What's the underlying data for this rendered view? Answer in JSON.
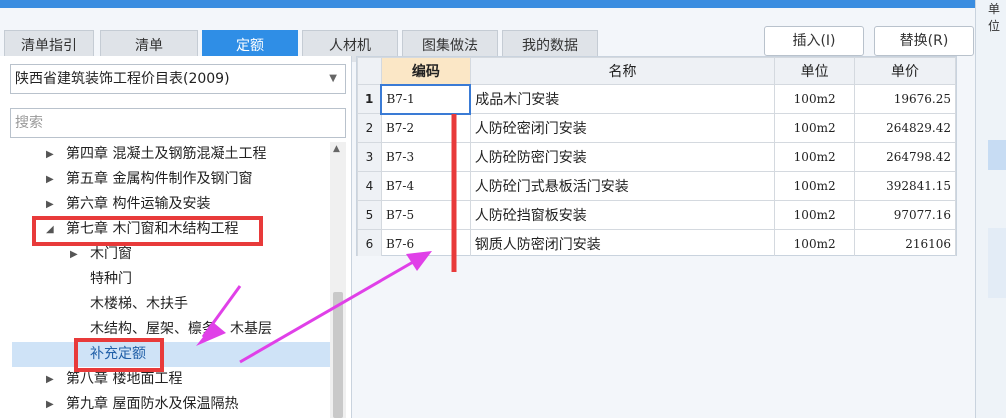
{
  "tabs": [
    {
      "label": "清单指引",
      "active": false
    },
    {
      "label": "清单",
      "active": false
    },
    {
      "label": "定额",
      "active": true
    },
    {
      "label": "人材机",
      "active": false
    },
    {
      "label": "图集做法",
      "active": false
    },
    {
      "label": "我的数据",
      "active": false
    }
  ],
  "buttons": {
    "insert": "插入(I)",
    "replace": "替换(R)"
  },
  "right_strip_label": "单位",
  "library": {
    "selected": "陕西省建筑装饰工程价目表(2009)"
  },
  "search": {
    "placeholder": "搜索"
  },
  "tree": [
    {
      "label": "第四章 混凝土及钢筋混凝土工程",
      "arrow": "▶"
    },
    {
      "label": "第五章 金属构件制作及钢门窗",
      "arrow": "▶"
    },
    {
      "label": "第六章 构件运输及安装",
      "arrow": "▶"
    },
    {
      "label": "第七章 木门窗和木结构工程",
      "arrow": "◢"
    },
    {
      "label": "木门窗",
      "arrow": "▶"
    },
    {
      "label": "特种门",
      "arrow": ""
    },
    {
      "label": "木楼梯、木扶手",
      "arrow": ""
    },
    {
      "label": "木结构、屋架、檩条、木基层",
      "arrow": ""
    },
    {
      "label": "补充定额",
      "arrow": ""
    },
    {
      "label": "第八章 楼地面工程",
      "arrow": "▶"
    },
    {
      "label": "第九章 屋面防水及保温隔热",
      "arrow": "▶"
    }
  ],
  "table": {
    "columns": [
      "编码",
      "名称",
      "单位",
      "单价"
    ],
    "rows": [
      {
        "num": "1",
        "code": "B7-1",
        "name": "成品木门安装",
        "unit": "100m2",
        "price": "19676.25"
      },
      {
        "num": "2",
        "code": "B7-2",
        "name": "人防砼密闭门安装",
        "unit": "100m2",
        "price": "264829.42"
      },
      {
        "num": "3",
        "code": "B7-3",
        "name": "人防砼防密门安装",
        "unit": "100m2",
        "price": "264798.42"
      },
      {
        "num": "4",
        "code": "B7-4",
        "name": "人防砼门式悬板活门安装",
        "unit": "100m2",
        "price": "392841.15"
      },
      {
        "num": "5",
        "code": "B7-5",
        "name": "人防砼挡窗板安装",
        "unit": "100m2",
        "price": "97077.16"
      },
      {
        "num": "6",
        "code": "B7-6",
        "name": "钢质人防密闭门安装",
        "unit": "100m2",
        "price": "216106"
      }
    ]
  },
  "colors": {
    "accent": "#2f8ee6",
    "highlight": "#e83a3a",
    "annotation": "#e040e8",
    "selected_row": "#cfe3f7"
  }
}
